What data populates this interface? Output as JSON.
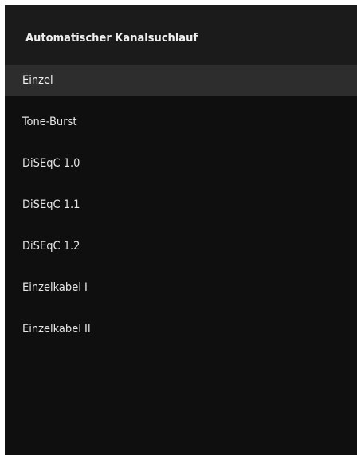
{
  "dialog": {
    "title": "Automatischer Kanalsuchlauf"
  },
  "options": [
    {
      "label": "Einzel",
      "selected": true
    },
    {
      "label": "Tone-Burst",
      "selected": false
    },
    {
      "label": "DiSEqC 1.0",
      "selected": false
    },
    {
      "label": "DiSEqC 1.1",
      "selected": false
    },
    {
      "label": "DiSEqC 1.2",
      "selected": false
    },
    {
      "label": "Einzelkabel I",
      "selected": false
    },
    {
      "label": "Einzelkabel II",
      "selected": false
    }
  ],
  "colors": {
    "header_bg": "#1b1b1b",
    "list_bg": "#0f0f0f",
    "selected_bg": "#2d2d2d",
    "text": "#e6e6e6"
  }
}
